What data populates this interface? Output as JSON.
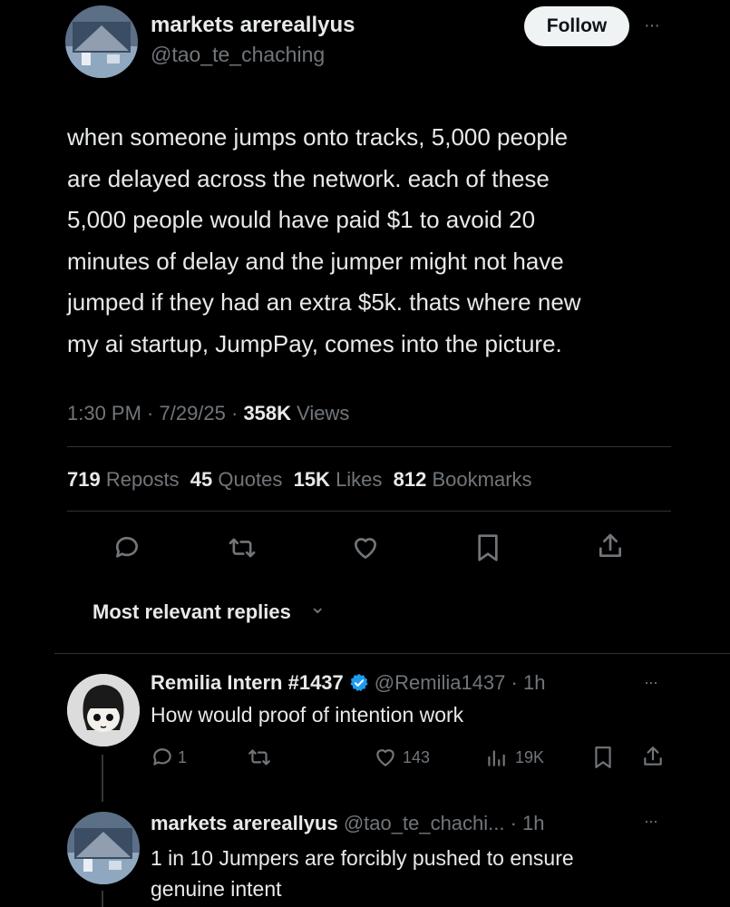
{
  "post": {
    "author_name": "markets arereallyus",
    "author_handle": "@tao_te_chaching",
    "follow_label": "Follow",
    "more_glyph": "···",
    "body_lines": [
      "when someone jumps onto tracks, 5,000 people",
      "are delayed across the network. each of these",
      "5,000 people would have paid $1 to avoid 20",
      "minutes of delay and the jumper might not have",
      "jumped if they had an extra $5k. thats where new",
      "my ai startup, JumpPay, comes into the picture."
    ],
    "meta_time": "1:30 PM · 7/29/25 · ",
    "meta_views_num": "358K",
    "meta_views_label": " Views",
    "stats": [
      {
        "num": "719",
        "label": "Reposts"
      },
      {
        "num": "45",
        "label": "Quotes"
      },
      {
        "num": "15K",
        "label": "Likes"
      },
      {
        "num": "812",
        "label": "Bookmarks"
      }
    ]
  },
  "sort": {
    "label": "Most relevant replies",
    "chevron": "⌄"
  },
  "replies": [
    {
      "author_name": "Remilia Intern #1437",
      "verified": true,
      "handle_time": "@Remilia1437 · 1h",
      "more_glyph": "···",
      "text": "How would proof of intention work",
      "reply_count": "1",
      "like_count": "143",
      "views_count": "19K"
    },
    {
      "author_name": "markets arereallyus",
      "handle_time": "@tao_te_chachi... · 1h",
      "more_glyph": "···",
      "text_lines": [
        "1 in 10 Jumpers are forcibly pushed to ensure",
        "genuine intent"
      ]
    }
  ],
  "icons": {
    "reply": "speech-bubble-icon",
    "repost": "repost-arrows-icon",
    "like": "heart-icon",
    "bookmark": "bookmark-icon",
    "share": "share-upload-icon",
    "views": "bar-chart-icon",
    "verified": "verified-badge-icon"
  },
  "colors": {
    "accent_blue": "#1d9bf0",
    "text": "#e7e9ea",
    "muted": "#71767b",
    "divider": "#2f3336"
  }
}
